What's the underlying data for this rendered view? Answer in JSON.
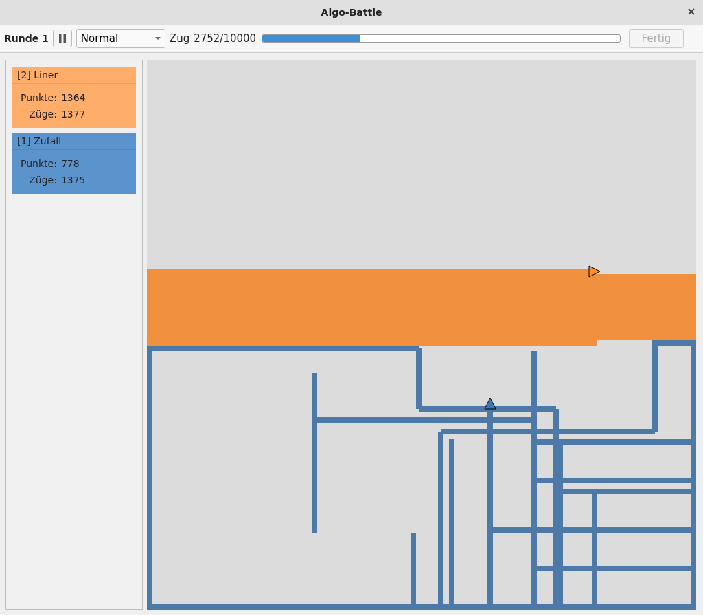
{
  "window": {
    "title": "Algo-Battle"
  },
  "toolbar": {
    "round_label": "Runde 1",
    "speed": {
      "value": "Normal"
    },
    "move_label": "Zug",
    "move_reading": "2752/10000",
    "progress": {
      "level": 0.272
    },
    "finish_button": {
      "label": "Fertig",
      "disabled": true
    }
  },
  "players": [
    {
      "name": "[2] Liner",
      "color": "#ffad6a",
      "stats": [
        {
          "label": "Punkte:",
          "value": "1364"
        },
        {
          "label": "Züge:",
          "value": "1377"
        }
      ]
    },
    {
      "name": "[1] Zufall",
      "color": "#5b93cc",
      "stats": [
        {
          "label": "Punkte:",
          "value": "778"
        },
        {
          "label": "Züge:",
          "value": "1375"
        }
      ]
    }
  ]
}
